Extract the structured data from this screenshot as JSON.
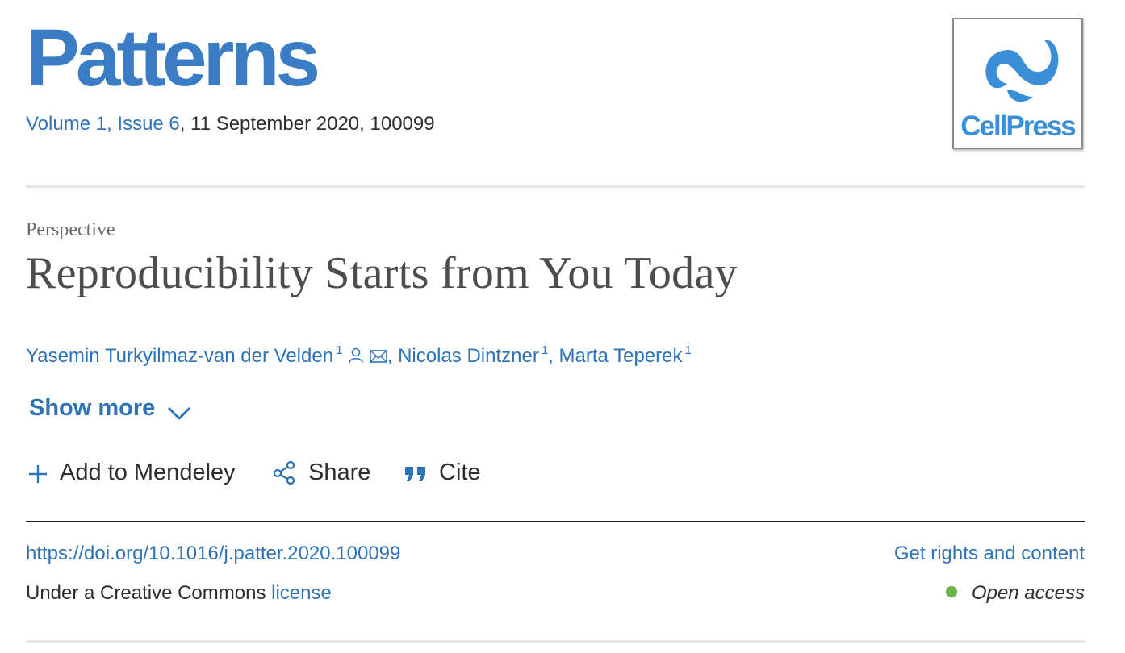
{
  "journal": {
    "title": "Patterns",
    "volume_link": "Volume 1, Issue 6",
    "issue_rest": ", 11 September 2020, 100099"
  },
  "publisher": {
    "logo_text": "CellPress",
    "color": "#3a8fd6"
  },
  "article": {
    "type": "Perspective",
    "title": "Reproducibility Starts from You Today"
  },
  "authors": [
    {
      "name": "Yasemin Turkyilmaz-van der Velden",
      "sup": "1"
    },
    {
      "name": "Nicolas Dintzner",
      "sup": "1"
    },
    {
      "name": "Marta Teperek",
      "sup": "1"
    }
  ],
  "author_separator": ", ",
  "show_more": {
    "label": "Show more"
  },
  "actions": {
    "mendeley": "Add to Mendeley",
    "share": "Share",
    "cite": "Cite"
  },
  "links": {
    "doi": "https://doi.org/10.1016/j.patter.2020.100099",
    "rights": "Get rights and content"
  },
  "license": {
    "prefix": "Under a Creative Commons ",
    "link": "license"
  },
  "access": {
    "label": "Open access",
    "dot_color": "#6bb34a"
  },
  "colors": {
    "link": "#2e73b8",
    "brand": "#3a7cc6"
  }
}
